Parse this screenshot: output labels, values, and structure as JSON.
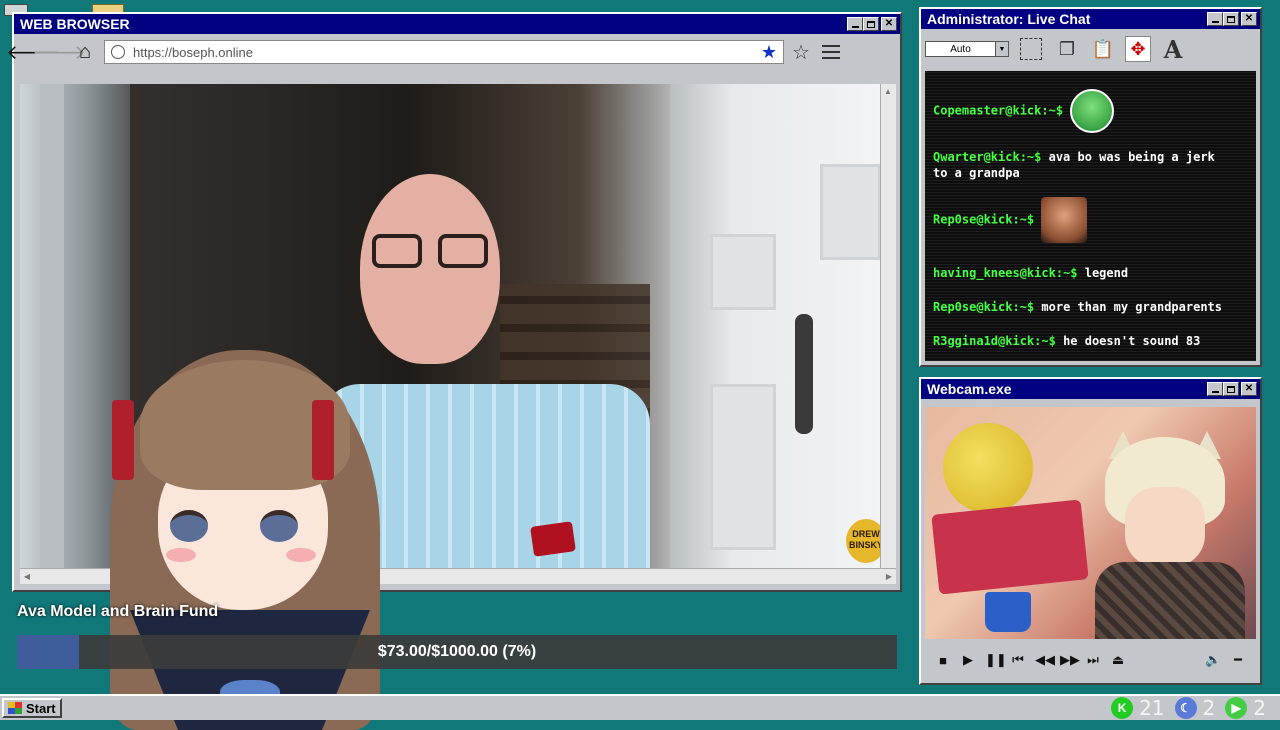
{
  "browser": {
    "title": "WEB BROWSER",
    "url": "https://boseph.online",
    "video_watermark": "DREW BINSKY"
  },
  "chat": {
    "title": "Administrator: Live Chat",
    "font_combo": "Auto",
    "messages": [
      {
        "user": "Copemaster@kick:~$",
        "text": "",
        "emote": "green-crying-emote"
      },
      {
        "user": "Qwarter@kick:~$",
        "text": "ava bo was being a jerk to a grandpa",
        "emote": ""
      },
      {
        "user": "Rep0se@kick:~$",
        "text": "",
        "emote": "shocked-face-emote"
      },
      {
        "user": "having_knees@kick:~$",
        "text": "legend",
        "emote": ""
      },
      {
        "user": "Rep0se@kick:~$",
        "text": "more than my grandparents",
        "emote": ""
      },
      {
        "user": "R3ggina1d@kick:~$",
        "text": "he doesn't sound 83",
        "emote": ""
      }
    ]
  },
  "webcam": {
    "title": "Webcam.exe"
  },
  "fund": {
    "title": "Ava Model and Brain Fund",
    "progress_text": "$73.00/$1000.00 (7%)",
    "raised": 73.0,
    "goal": 1000.0,
    "percent": 7,
    "color": "#3e5c9a"
  },
  "taskbar": {
    "start_label": "Start",
    "tray": [
      {
        "icon": "kick-icon",
        "value": "21",
        "color": "#22cc22"
      },
      {
        "icon": "moon-icon",
        "value": "2",
        "color": "#5a7ad8"
      },
      {
        "icon": "play-icon",
        "value": "2",
        "color": "#44cc44"
      }
    ]
  }
}
